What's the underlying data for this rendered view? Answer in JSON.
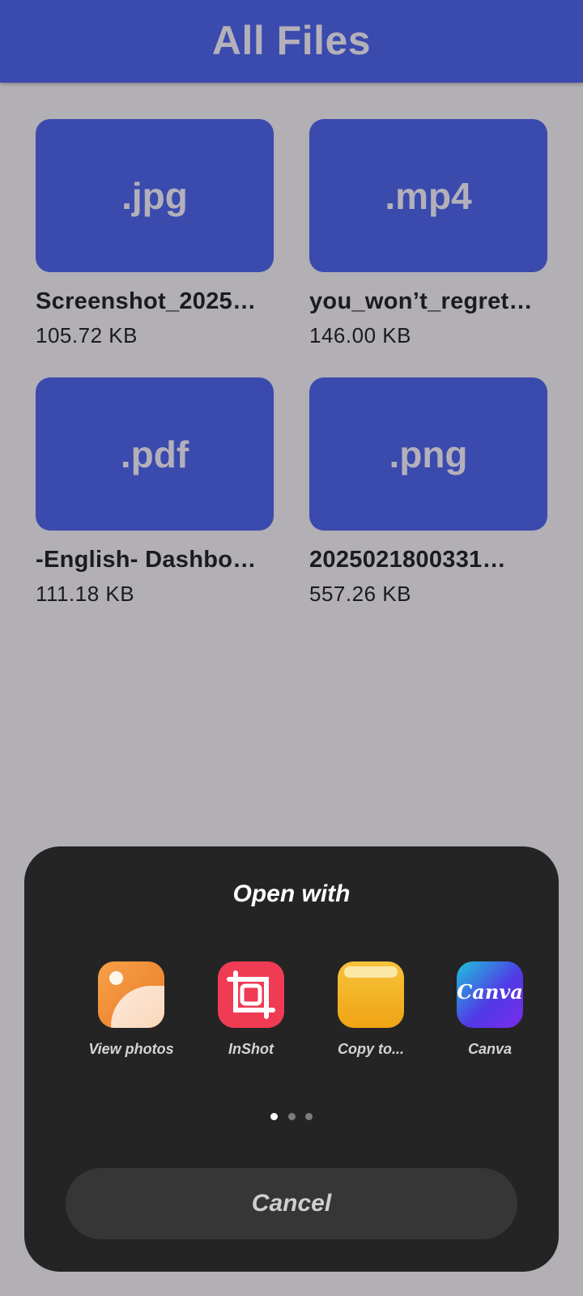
{
  "header": {
    "title": "All Files"
  },
  "files": [
    {
      "extension": ".jpg",
      "name": "Screenshot_2025…",
      "size": "105.72 KB"
    },
    {
      "extension": ".mp4",
      "name": "you_won’t_regret…",
      "size": "146.00 KB"
    },
    {
      "extension": ".pdf",
      "name": "-English- Dashbo…",
      "size": "111.18 KB"
    },
    {
      "extension": ".png",
      "name": "2025021800331…",
      "size": "557.26 KB"
    }
  ],
  "sheet": {
    "title": "Open with",
    "apps": [
      {
        "label": "View photos",
        "icon": "photos-icon"
      },
      {
        "label": "InShot",
        "icon": "inshot-icon"
      },
      {
        "label": "Copy to...",
        "icon": "folder-icon"
      },
      {
        "label": "Canva",
        "icon": "canva-icon",
        "logo_text": "Canva"
      }
    ],
    "page_indicator": {
      "count": 3,
      "active": 1
    },
    "cancel_label": "Cancel"
  },
  "colors": {
    "header_bg": "#3a4aad",
    "page_bg": "#b2afb5",
    "sheet_bg": "#242424"
  }
}
